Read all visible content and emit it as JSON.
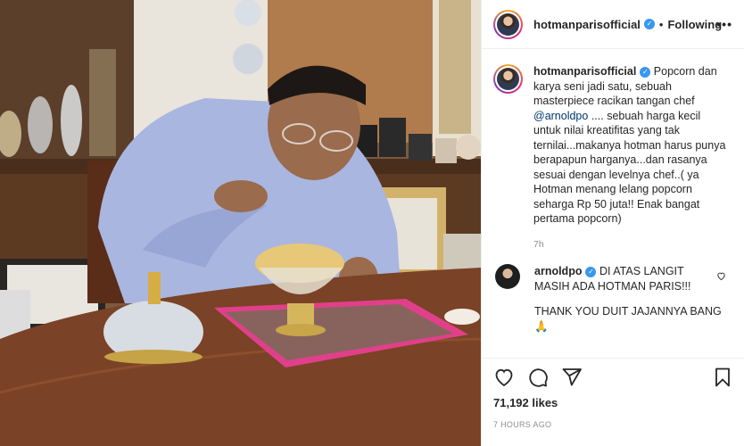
{
  "post": {
    "username": "hotmanparisofficial",
    "dot": "•",
    "follow_status": "Following",
    "more": "•••"
  },
  "caption": {
    "username": "hotmanparisofficial",
    "text_before": "Popcorn dan karya seni jadi satu, sebuah masterpiece racikan tangan chef",
    "mention": "@arnoldpo",
    "text_after": ".... sebuah harga kecil untuk nilai kreatifitas yang tak ternilai...makanya hotman harus punya berapapun harganya...dan rasanya sesuai dengan levelnya chef..( ya Hotman menang lelang popcorn seharga Rp 50 juta!! Enak bangat pertama popcorn)",
    "time": "7h"
  },
  "comment": {
    "username": "arnoldpo",
    "line1": "DI ATAS LANGIT MASIH ADA HOTMAN PARIS!!!",
    "line2": "THANK YOU DUIT JAJANNYA BANG 🙏"
  },
  "stats": {
    "likes": "71,192 likes",
    "posted": "7 HOURS AGO"
  },
  "icons": {
    "verified": "verified-badge-icon",
    "like": "heart-icon",
    "comment": "comment-bubble-icon",
    "share": "paper-plane-icon",
    "save": "bookmark-icon"
  },
  "colors": {
    "verified": "#3897f0",
    "mention": "#00376b",
    "muted": "#8e8e8e"
  }
}
